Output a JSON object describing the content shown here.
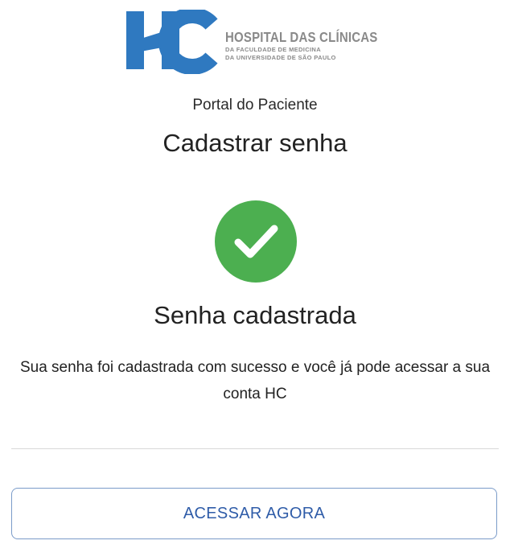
{
  "logo": {
    "mark": "HC",
    "line1": "HOSPITAL DAS CLÍNICAS",
    "line2": "DA FACULDADE DE MEDICINA",
    "line3": "DA UNIVERSIDADE DE SÃO PAULO",
    "brand_color": "#2f79c0"
  },
  "header": {
    "portal_label": "Portal do Paciente",
    "page_title": "Cadastrar senha"
  },
  "success": {
    "icon": "check-circle-icon",
    "icon_color": "#4caf50",
    "title": "Senha cadastrada",
    "message": "Sua senha foi cadastrada com sucesso e você já pode acessar a sua conta HC"
  },
  "actions": {
    "access_now_label": "ACESSAR AGORA",
    "button_color": "#2f5ca8"
  }
}
